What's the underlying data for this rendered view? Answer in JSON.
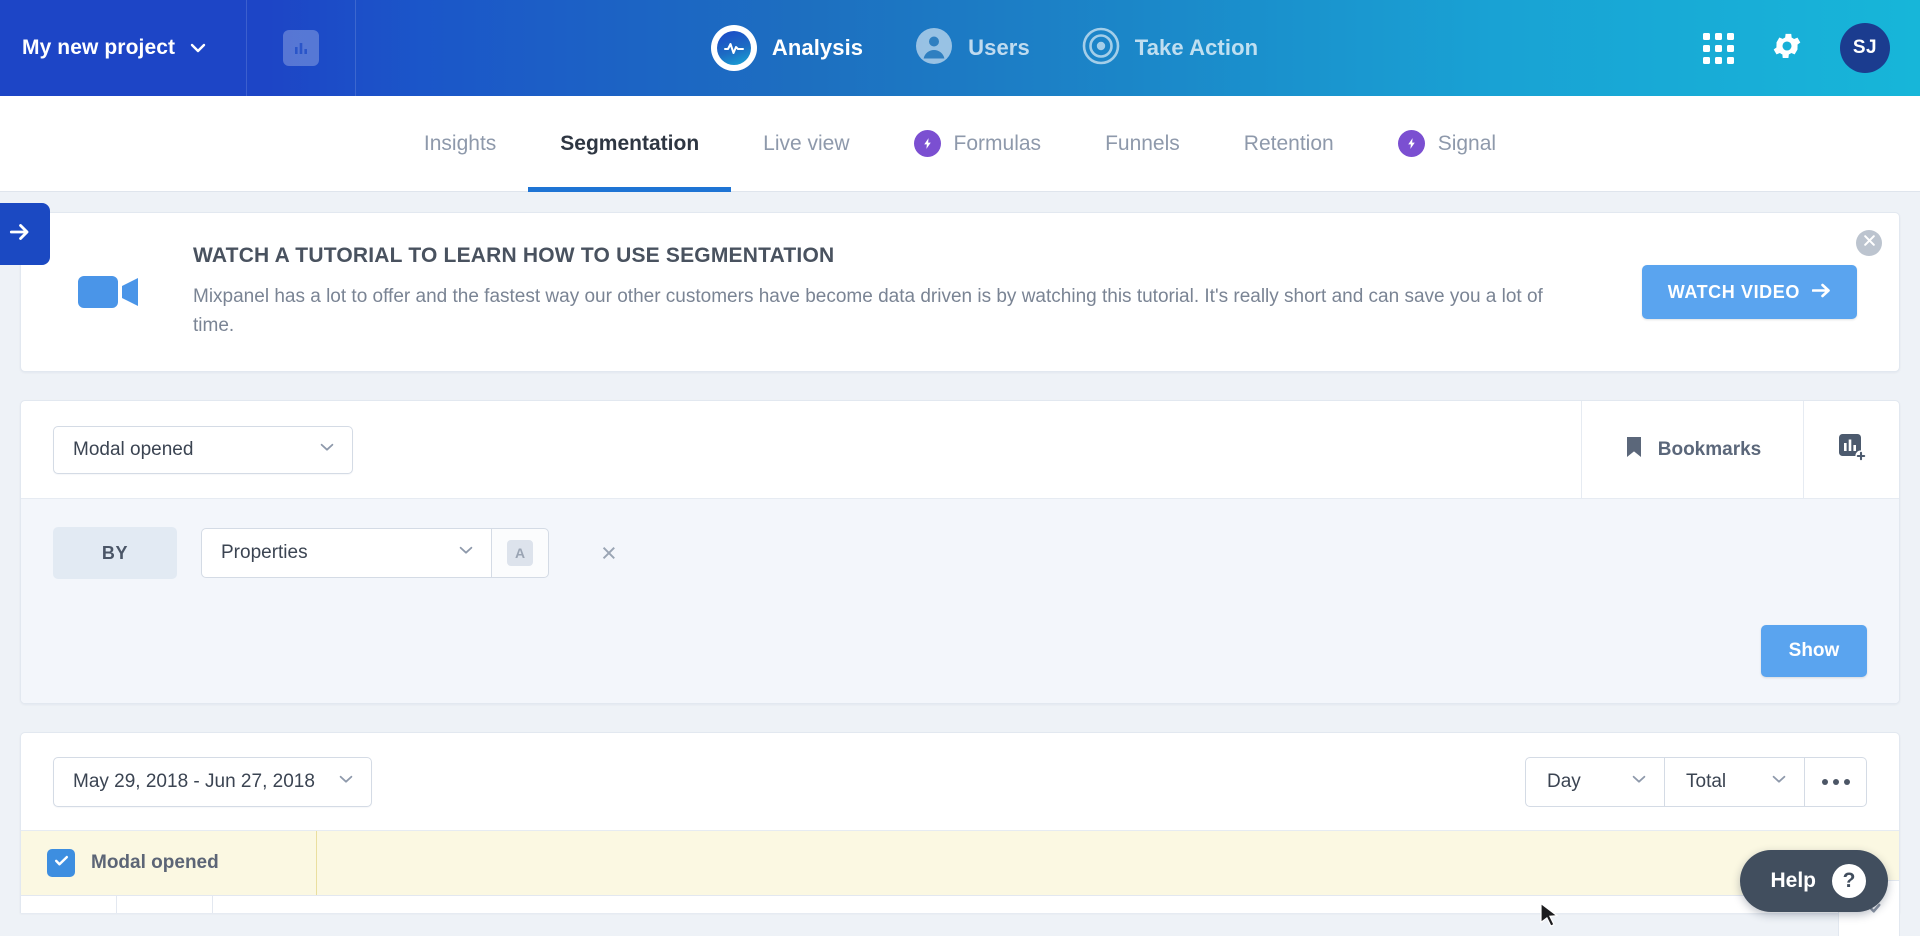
{
  "topbar": {
    "project_name": "My new project",
    "project_caret_icon": "chevron-down-icon",
    "chart_tile_icon": "bar-chart-icon",
    "nav": [
      {
        "label": "Analysis",
        "icon": "analysis-pulse-icon",
        "active": true
      },
      {
        "label": "Users",
        "icon": "user-circle-icon",
        "active": false
      },
      {
        "label": "Take Action",
        "icon": "target-icon",
        "active": false
      }
    ],
    "apps_icon": "grid-apps-icon",
    "settings_icon": "gear-icon",
    "avatar_initials": "SJ"
  },
  "sidebar_toggle": {
    "icon": "arrow-right-icon"
  },
  "subnav": {
    "tabs": [
      {
        "label": "Insights",
        "badge": null,
        "active": false
      },
      {
        "label": "Segmentation",
        "badge": null,
        "active": true
      },
      {
        "label": "Live view",
        "badge": null,
        "active": false
      },
      {
        "label": "Formulas",
        "badge": "bolt-icon",
        "active": false
      },
      {
        "label": "Funnels",
        "badge": null,
        "active": false
      },
      {
        "label": "Retention",
        "badge": null,
        "active": false
      },
      {
        "label": "Signal",
        "badge": "bolt-icon",
        "active": false
      }
    ]
  },
  "banner": {
    "video_icon": "video-camera-icon",
    "title": "WATCH A TUTORIAL TO LEARN HOW TO USE SEGMENTATION",
    "body": "Mixpanel has a lot to offer and the fastest way our other customers have become data driven is by watching this tutorial. It's really short and can save you a lot of time.",
    "cta_label": "WATCH VIDEO",
    "cta_arrow_icon": "arrow-right-icon",
    "close_icon": "close-circle-icon",
    "cta_color": "#5aa4ef"
  },
  "query": {
    "event_select": "Modal opened",
    "event_caret_icon": "chevron-down-icon",
    "bookmarks_label": "Bookmarks",
    "bookmarks_icon": "bookmark-icon",
    "add_chart_icon": "add-chart-icon",
    "by_label": "BY",
    "property_select": "Properties",
    "property_caret_icon": "chevron-down-icon",
    "az_sort_label": "A",
    "az_sort_icon": "sort-alpha-icon",
    "remove_icon": "close-icon",
    "show_label": "Show",
    "show_color": "#5aa4ef"
  },
  "results": {
    "date_range": "May 29, 2018 - Jun 27, 2018",
    "date_caret_icon": "chevron-down-icon",
    "interval": "Day",
    "interval_caret_icon": "chevron-down-icon",
    "aggregation": "Total",
    "aggregation_caret_icon": "chevron-down-icon",
    "more_icon": "more-horizontal-icon",
    "legend_item": "Modal opened",
    "legend_checkbox_icon": "checkmark-icon",
    "legend_checked": true,
    "list_toggle_icon": "list-check-icon",
    "highlight_color": "#fbf8e2"
  },
  "help": {
    "label": "Help",
    "icon": "question-mark-icon"
  },
  "cursor": {
    "icon": "mouse-pointer-icon"
  }
}
